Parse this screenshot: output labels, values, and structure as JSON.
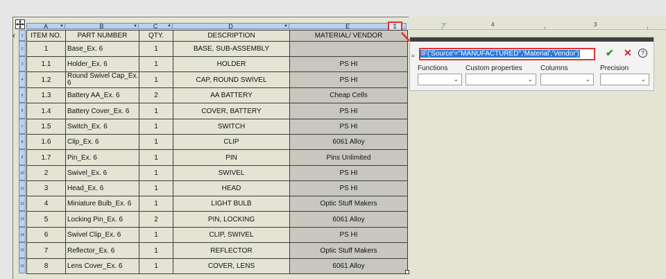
{
  "columns": [
    {
      "letter": "A"
    },
    {
      "letter": "B"
    },
    {
      "letter": "C"
    },
    {
      "letter": "D"
    },
    {
      "letter": "E"
    }
  ],
  "sigma_label": "Σ",
  "header": {
    "item_no": "ITEM NO.",
    "part_number": "PART NUMBER",
    "qty": "QTY.",
    "description": "DESCRIPTION",
    "material": "MATERIAL/ VENDOR"
  },
  "rows": [
    {
      "item": "1",
      "part": "Base_Ex. 6",
      "qty": "1",
      "desc": "BASE, SUB-ASSEMBLY",
      "mat": ""
    },
    {
      "item": "1.1",
      "part": "Holder_Ex. 6",
      "qty": "1",
      "desc": "HOLDER",
      "mat": "PS HI"
    },
    {
      "item": "1.2",
      "part": "Round Swivel Cap_Ex. 6",
      "qty": "1",
      "desc": "CAP, ROUND SWIVEL",
      "mat": "PS HI"
    },
    {
      "item": "1.3",
      "part": "Battery AA_Ex. 6",
      "qty": "2",
      "desc": "AA BATTERY",
      "mat": "Cheap Cells"
    },
    {
      "item": "1.4",
      "part": "Battery Cover_Ex. 6",
      "qty": "1",
      "desc": "COVER, BATTERY",
      "mat": "PS HI"
    },
    {
      "item": "1.5",
      "part": "Switch_Ex. 6",
      "qty": "1",
      "desc": "SWITCH",
      "mat": "PS HI"
    },
    {
      "item": "1.6",
      "part": "Clip_Ex. 6",
      "qty": "1",
      "desc": "CLIP",
      "mat": "6061 Alloy"
    },
    {
      "item": "1.7",
      "part": "Pin_Ex. 6",
      "qty": "1",
      "desc": "PIN",
      "mat": "Pins Unlimited"
    },
    {
      "item": "2",
      "part": "Swivel_Ex. 6",
      "qty": "1",
      "desc": "SWIVEL",
      "mat": "PS HI"
    },
    {
      "item": "3",
      "part": "Head_Ex. 6",
      "qty": "1",
      "desc": "HEAD",
      "mat": "PS HI"
    },
    {
      "item": "4",
      "part": "Miniature Bulb_Ex. 6",
      "qty": "1",
      "desc": "LIGHT BULB",
      "mat": "Optic Stuff Makers"
    },
    {
      "item": "5",
      "part": "Locking Pin_Ex. 6",
      "qty": "2",
      "desc": "PIN, LOCKING",
      "mat": "6061 Alloy"
    },
    {
      "item": "6",
      "part": "Swivel Clip_Ex. 6",
      "qty": "1",
      "desc": "CLIP, SWIVEL",
      "mat": "PS HI"
    },
    {
      "item": "7",
      "part": "Reflector_Ex. 6",
      "qty": "1",
      "desc": "REFLECTOR",
      "mat": "Optic Stuff Makers"
    },
    {
      "item": "8",
      "part": "Lens Cover_Ex. 6",
      "qty": "1",
      "desc": "COVER, LENS",
      "mat": "6061 Alloy"
    }
  ],
  "row_numbers": [
    "1",
    "2",
    "3",
    "4",
    "5",
    "6",
    "7",
    "8",
    "9",
    "10",
    "11",
    "12",
    "13",
    "14",
    "15",
    "16"
  ],
  "ruler": {
    "label_left": "4",
    "label_right": "3"
  },
  "editor": {
    "equals": "=",
    "formula": "IF('Source'=\"MANUFACTURED\",'Material','Vendor')",
    "ok": "✔",
    "cancel": "✕",
    "help": "?",
    "functions_label": "Functions",
    "custom_props_label": "Custom properties",
    "columns_label": "Columns",
    "precision_label": "Precision"
  },
  "colors": {
    "accent_red": "#e03030",
    "selection_blue": "#2b79d6",
    "header_blue": "#bcd2ec",
    "ok_green": "#2e9b2e"
  }
}
